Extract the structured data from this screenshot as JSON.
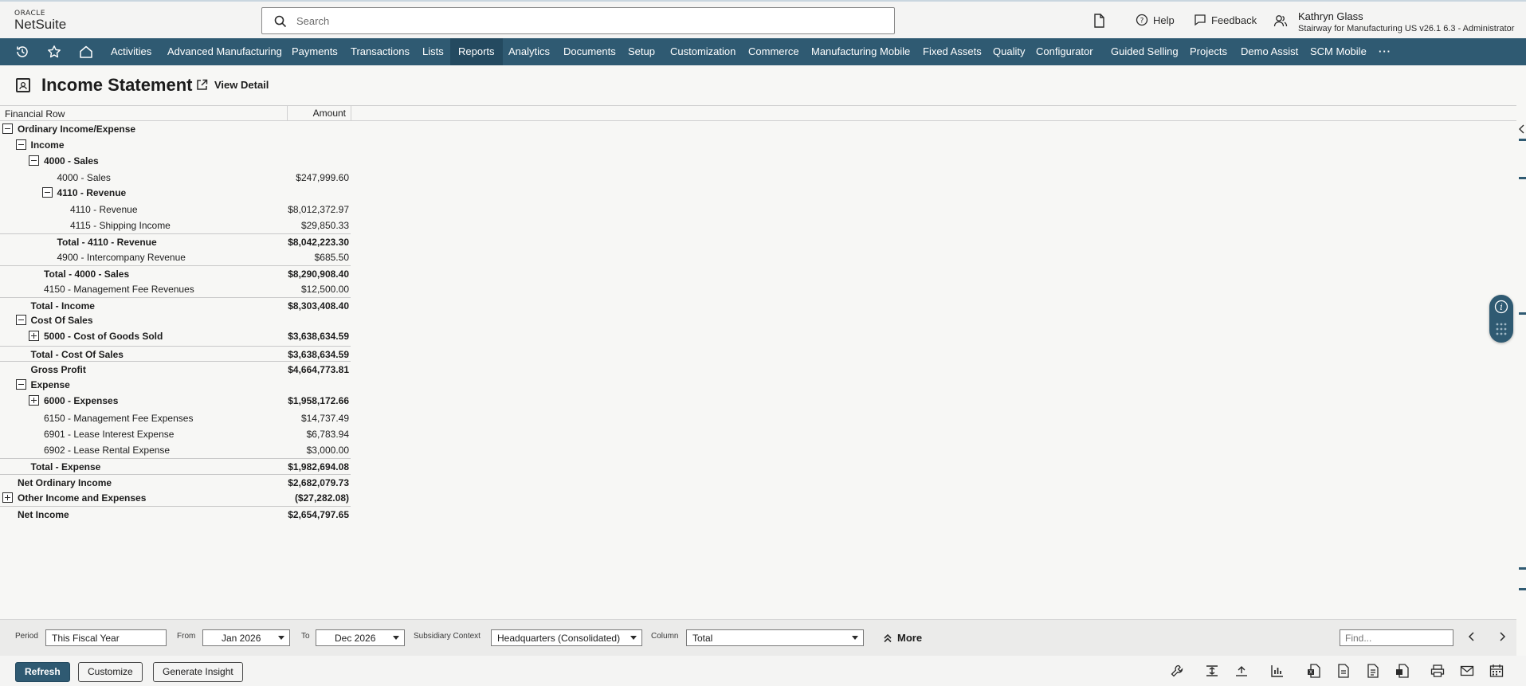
{
  "header": {
    "logo_oracle": "ORACLE",
    "logo_netsuite": "NetSuite",
    "search_placeholder": "Search",
    "help": "Help",
    "feedback": "Feedback",
    "user_name": "Kathryn Glass",
    "user_role": "Stairway for Manufacturing US v26.1 6.3 - Administrator"
  },
  "nav": {
    "items": [
      "Activities",
      "Advanced Manufacturing",
      "Payments",
      "Transactions",
      "Lists",
      "Reports",
      "Analytics",
      "Documents",
      "Setup",
      "Customization",
      "Commerce",
      "Manufacturing Mobile",
      "Fixed Assets",
      "Quality",
      "Configurator",
      "Guided Selling",
      "Projects",
      "Demo Assist",
      "SCM Mobile"
    ],
    "active": "Reports",
    "more": "···"
  },
  "page": {
    "title": "Income Statement",
    "view_detail": "View Detail"
  },
  "grid": {
    "col_financial_row": "Financial Row",
    "col_amount": "Amount",
    "rows": [
      {
        "label": "Ordinary Income/Expense",
        "amount": "",
        "level": 0,
        "toggle": "minus",
        "bold": true,
        "line": false
      },
      {
        "label": "Income",
        "amount": "",
        "level": 1,
        "toggle": "minus",
        "bold": true,
        "line": false
      },
      {
        "label": "4000 - Sales",
        "amount": "",
        "level": 2,
        "toggle": "minus",
        "bold": true,
        "line": false
      },
      {
        "label": "4000 - Sales",
        "amount": "$247,999.60",
        "level": 3,
        "toggle": "",
        "bold": false,
        "line": false
      },
      {
        "label": "4110 - Revenue",
        "amount": "",
        "level": 3,
        "toggle": "minus",
        "bold": true,
        "line": false
      },
      {
        "label": "4110 - Revenue",
        "amount": "$8,012,372.97",
        "level": 4,
        "toggle": "",
        "bold": false,
        "line": false
      },
      {
        "label": "4115 - Shipping Income",
        "amount": "$29,850.33",
        "level": 4,
        "toggle": "",
        "bold": false,
        "line": false
      },
      {
        "label": "Total - 4110 - Revenue",
        "amount": "$8,042,223.30",
        "level": 3,
        "toggle": "",
        "bold": true,
        "line": true
      },
      {
        "label": "4900 - Intercompany Revenue",
        "amount": "$685.50",
        "level": 3,
        "toggle": "",
        "bold": false,
        "line": false
      },
      {
        "label": "Total - 4000 - Sales",
        "amount": "$8,290,908.40",
        "level": 2,
        "toggle": "",
        "bold": true,
        "line": true
      },
      {
        "label": "4150 - Management Fee Revenues",
        "amount": "$12,500.00",
        "level": 2,
        "toggle": "",
        "bold": false,
        "line": false
      },
      {
        "label": "Total - Income",
        "amount": "$8,303,408.40",
        "level": 1,
        "toggle": "",
        "bold": true,
        "line": true
      },
      {
        "label": "Cost Of Sales",
        "amount": "",
        "level": 1,
        "toggle": "minus",
        "bold": true,
        "line": false
      },
      {
        "label": "5000 - Cost of Goods Sold",
        "amount": "$3,638,634.59",
        "level": 2,
        "toggle": "plus",
        "bold": true,
        "line": false
      },
      {
        "label": "Total - Cost Of Sales",
        "amount": "$3,638,634.59",
        "level": 1,
        "toggle": "",
        "bold": true,
        "line": true
      },
      {
        "label": "Gross Profit",
        "amount": "$4,664,773.81",
        "level": 1,
        "toggle": "",
        "bold": true,
        "line": true
      },
      {
        "label": "Expense",
        "amount": "",
        "level": 1,
        "toggle": "minus",
        "bold": true,
        "line": false
      },
      {
        "label": "6000 - Expenses",
        "amount": "$1,958,172.66",
        "level": 2,
        "toggle": "plus",
        "bold": true,
        "line": false
      },
      {
        "label": "6150 - Management Fee Expenses",
        "amount": "$14,737.49",
        "level": 2,
        "toggle": "",
        "bold": false,
        "line": false
      },
      {
        "label": "6901 - Lease Interest Expense",
        "amount": "$6,783.94",
        "level": 2,
        "toggle": "",
        "bold": false,
        "line": false
      },
      {
        "label": "6902 - Lease Rental Expense",
        "amount": "$3,000.00",
        "level": 2,
        "toggle": "",
        "bold": false,
        "line": false
      },
      {
        "label": "Total - Expense",
        "amount": "$1,982,694.08",
        "level": 1,
        "toggle": "",
        "bold": true,
        "line": true
      },
      {
        "label": "Net Ordinary Income",
        "amount": "$2,682,079.73",
        "level": 0,
        "toggle": "",
        "bold": true,
        "line": true
      },
      {
        "label": "Other Income and Expenses",
        "amount": "($27,282.08)",
        "level": 0,
        "toggle": "plus",
        "bold": true,
        "line": false
      },
      {
        "label": "Net Income",
        "amount": "$2,654,797.65",
        "level": 0,
        "toggle": "",
        "bold": true,
        "line": true
      }
    ]
  },
  "filters": {
    "period_label": "Period",
    "period_value": "This Fiscal Year",
    "from_label": "From",
    "from_value": "Jan 2026",
    "to_label": "To",
    "to_value": "Dec 2026",
    "subsidiary_label": "Subsidiary Context",
    "subsidiary_value": "Headquarters (Consolidated)",
    "column_label": "Column",
    "column_value": "Total",
    "more": "More",
    "find_placeholder": "Find..."
  },
  "actions": {
    "refresh": "Refresh",
    "customize": "Customize",
    "generate_insight": "Generate Insight"
  },
  "colors": {
    "nav_bg": "#2f5a72",
    "primary": "#2f5a72"
  }
}
